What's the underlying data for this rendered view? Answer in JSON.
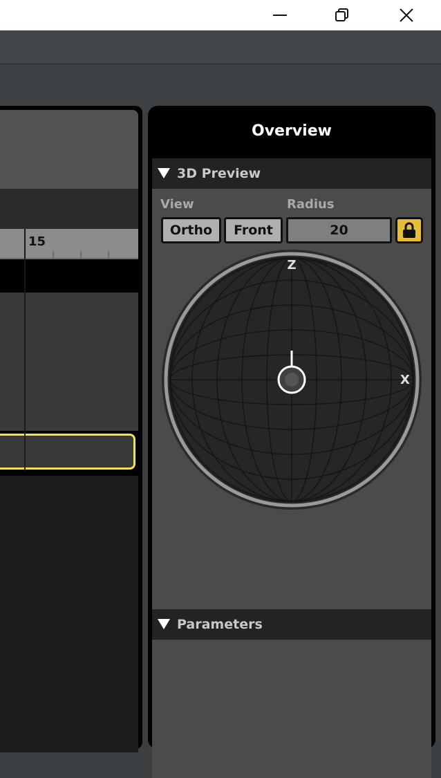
{
  "window": {
    "controls": {
      "minimize_icon": "minimize-icon",
      "restore_icon": "restore-icon",
      "close_icon": "close-icon"
    }
  },
  "timeline": {
    "ruler_label": "15",
    "clip_border_color": "#f0e34c"
  },
  "overview": {
    "title": "Overview",
    "preview_section": {
      "label": "3D Preview",
      "view_label": "View",
      "radius_label": "Radius",
      "projection_button": "Ortho",
      "view_button": "Front",
      "radius_value": "20",
      "lock_icon": "lock-icon",
      "gizmo": {
        "z_label": "Z",
        "x_label": "X"
      }
    },
    "parameters_section": {
      "label": "Parameters"
    }
  },
  "colors": {
    "accent_lock": "#e5bd37",
    "panel_background": "#4b4b4b"
  }
}
